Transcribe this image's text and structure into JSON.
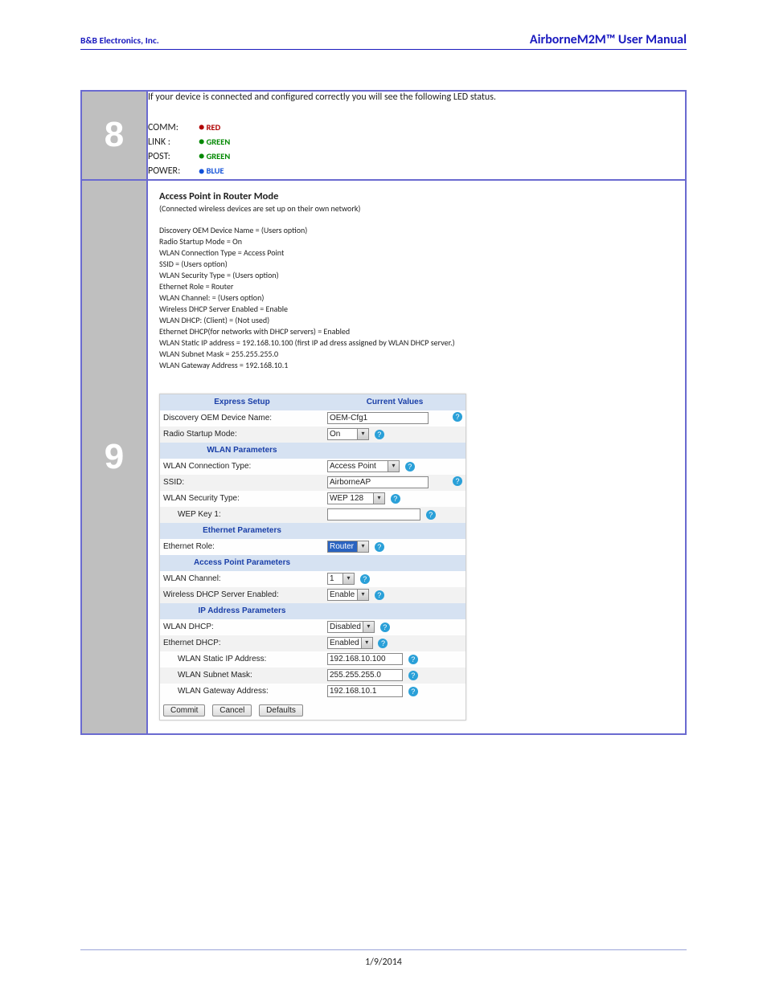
{
  "header": {
    "left": "B&B Electronics, Inc.",
    "right": "AirborneM2M™ User Manual"
  },
  "step8": {
    "num": "8",
    "intro": "If your device is connected and configured correctly you will see the following LED status.",
    "leds": [
      {
        "label": "COMM:",
        "color_class": "red",
        "status": "RED"
      },
      {
        "label": "LINK :",
        "color_class": "green",
        "status": "GREEN"
      },
      {
        "label": "POST:",
        "color_class": "green",
        "status": "GREEN"
      },
      {
        "label": "POWER:",
        "color_class": "blue",
        "status": "BLUE"
      }
    ]
  },
  "step9": {
    "num": "9",
    "title": "Access Point in Router Mode",
    "subtitle": "(Connected wireless devices are set up on their own network)",
    "config_lines": [
      "Discovery OEM Device Name = (Users option)",
      "Radio Startup Mode = On",
      "WLAN Connection Type = Access Point",
      "SSID = (Users option)",
      "WLAN Security Type = (Users option)",
      "Ethernet Role = Router",
      "WLAN Channel: = (Users option)",
      "Wireless DHCP Server Enabled = Enable",
      "WLAN DHCP: (Client) = (Not used)",
      "Ethernet DHCP(for networks with DHCP servers) = Enabled",
      "WLAN Static IP address = 192.168.10.100 (first IP ad dress assigned by WLAN DHCP server.)",
      "WLAN Subnet Mask = 255.255.255.0",
      "WLAN Gateway Address = 192.168.10.1"
    ],
    "ui": {
      "hdr_left": "Express Setup",
      "hdr_right": "Current Values",
      "rows": {
        "disc_name_lbl": "Discovery OEM Device Name:",
        "disc_name_val": "OEM-Cfg1",
        "radio_lbl": "Radio Startup Mode:",
        "radio_val": "On",
        "sec_wlan": "WLAN Parameters",
        "conn_lbl": "WLAN Connection Type:",
        "conn_val": "Access Point",
        "ssid_lbl": "SSID:",
        "ssid_val": "AirborneAP",
        "sectype_lbl": "WLAN Security Type:",
        "sectype_val": "WEP 128",
        "wep_lbl": "WEP Key 1:",
        "wep_val": "",
        "sec_eth": "Ethernet Parameters",
        "ethrole_lbl": "Ethernet Role:",
        "ethrole_val": "Router",
        "sec_ap": "Access Point Parameters",
        "chan_lbl": "WLAN Channel:",
        "chan_val": "1",
        "dhcpsrv_lbl": "Wireless DHCP Server Enabled:",
        "dhcpsrv_val": "Enable",
        "sec_ip": "IP Address Parameters",
        "wlandhcp_lbl": "WLAN DHCP:",
        "wlandhcp_val": "Disabled",
        "ethdhcp_lbl": "Ethernet DHCP:",
        "ethdhcp_val": "Enabled",
        "static_lbl": "WLAN Static IP Address:",
        "static_val": "192.168.10.100",
        "mask_lbl": "WLAN Subnet Mask:",
        "mask_val": "255.255.255.0",
        "gw_lbl": "WLAN Gateway Address:",
        "gw_val": "192.168.10.1"
      },
      "buttons": {
        "commit": "Commit",
        "cancel": "Cancel",
        "defaults": "Defaults"
      }
    }
  },
  "footer_date": "1/9/2014"
}
